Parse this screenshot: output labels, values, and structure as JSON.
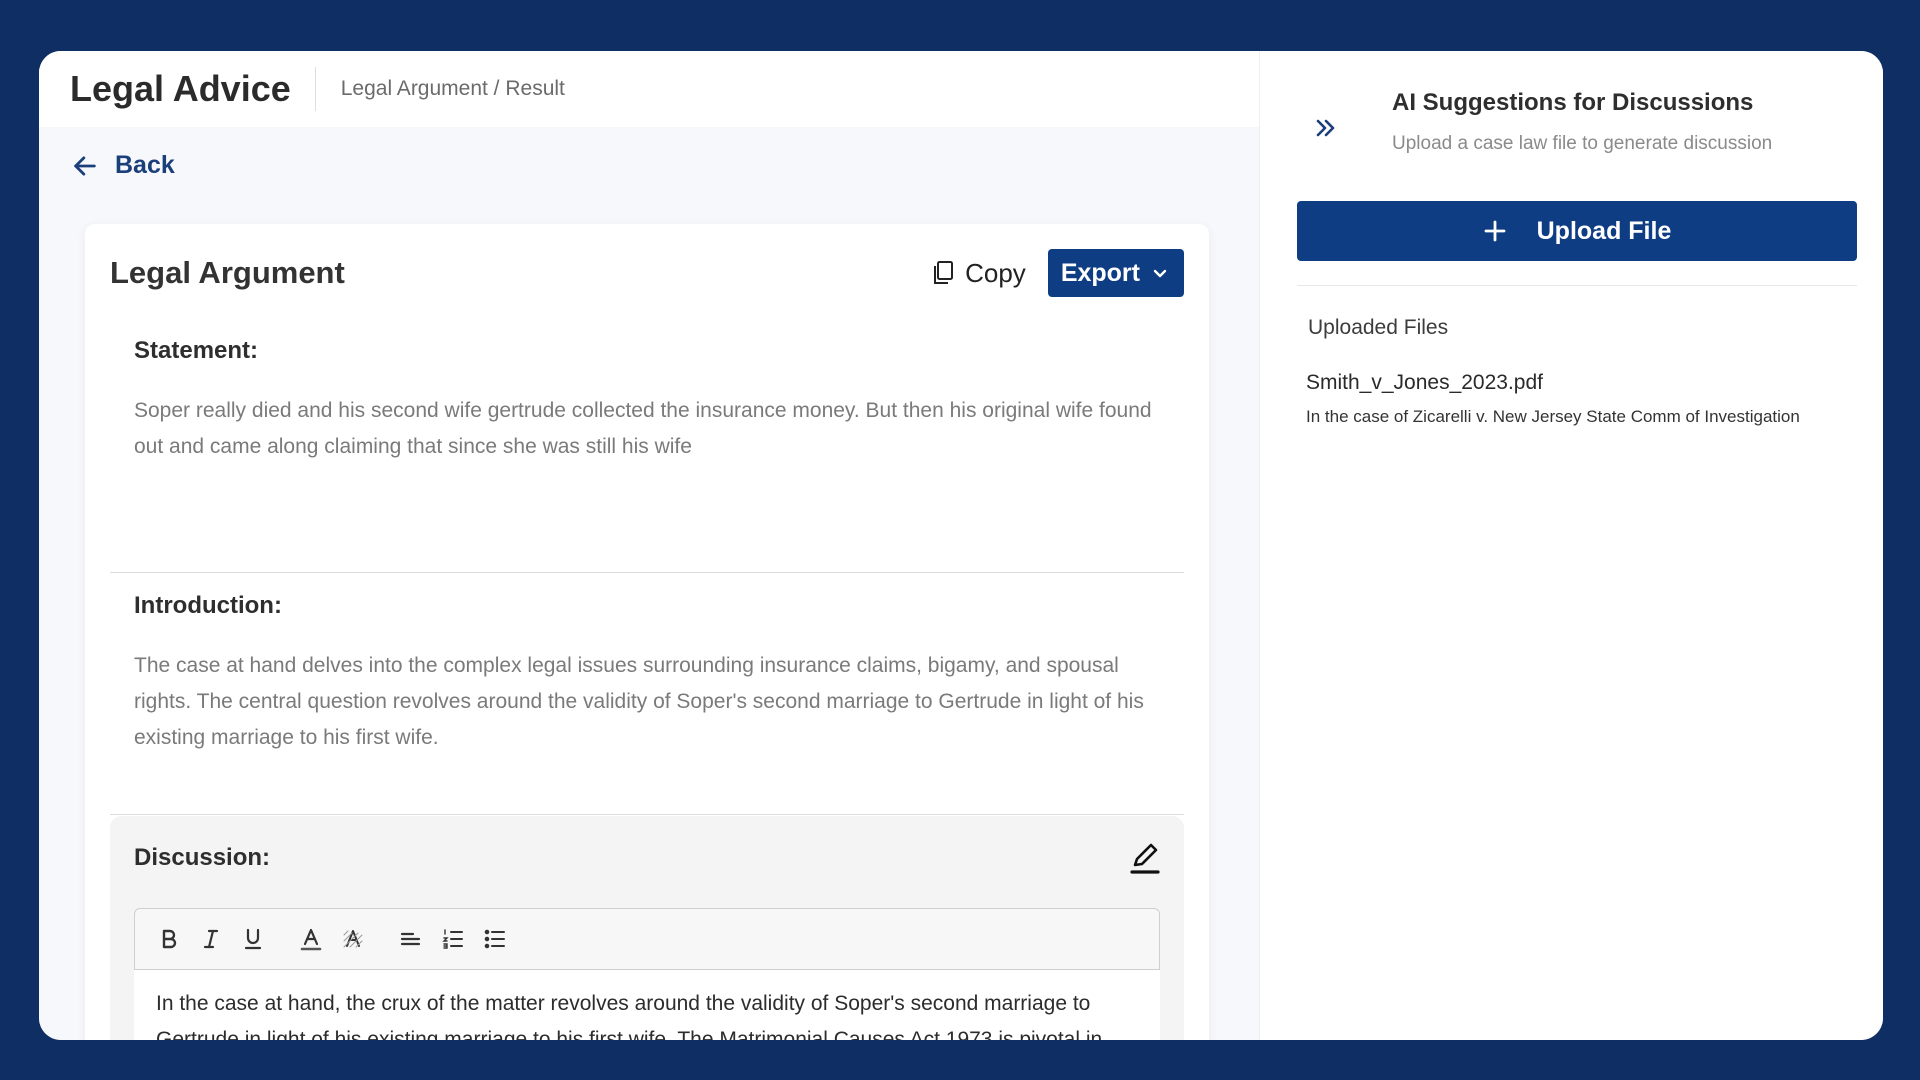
{
  "header": {
    "app_title": "Legal Advice",
    "breadcrumb": "Legal Argument / Result"
  },
  "nav": {
    "back_label": "Back",
    "back_icon": "arrow-left-icon"
  },
  "card": {
    "title": "Legal Argument",
    "copy_label": "Copy",
    "copy_icon": "copy-icon",
    "export_label": "Export",
    "export_icon": "chevron-down-icon",
    "statement": {
      "heading": "Statement:",
      "body": "Soper really died and his second wife gertrude collected the insurance money. But then his original wife found out and came along claiming that since she was still his wife"
    },
    "introduction": {
      "heading": "Introduction:",
      "body": "The case at hand delves into the complex legal issues surrounding insurance claims, bigamy, and spousal rights. The central question revolves around the validity of Soper's second marriage to Gertrude in light of his existing marriage to his first wife."
    },
    "discussion": {
      "heading": "Discussion:",
      "edit_icon": "pencil-edit-icon",
      "toolbar": [
        "bold-icon",
        "italic-icon",
        "underline-icon",
        "font-color-icon",
        "highlight-icon",
        "align-left-icon",
        "ordered-list-icon",
        "bullet-list-icon"
      ],
      "body": "In the case at hand, the crux of the matter revolves around the validity of Soper's second marriage to Gertrude in light of his existing marriage to his first wife. The Matrimonial Causes Act 1973 is pivotal in addressing issues related to divorce and spousal rights. According to"
    }
  },
  "sidebar": {
    "collapse_icon": "double-chevron-right-icon",
    "title": "AI Suggestions for Discussions",
    "subtitle": "Upload a case law file to generate discussion",
    "upload_label": "Upload File",
    "upload_icon": "plus-icon",
    "uploaded_heading": "Uploaded Files",
    "files": [
      {
        "name": "Smith_v_Jones_2023.pdf",
        "description": "In the case of Zicarelli v. New Jersey State Comm of Investigation"
      }
    ]
  },
  "colors": {
    "frame": "#0f2e63",
    "primary": "#0f3d84",
    "back_link": "#1a3f7a"
  }
}
